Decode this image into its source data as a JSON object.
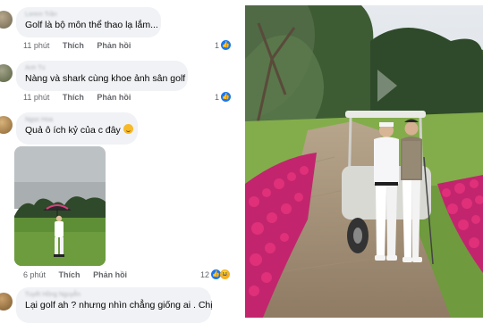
{
  "comments": [
    {
      "text": "Golf là bộ môn thể thao lạ lắm...",
      "time": "11 phút",
      "like_label": "Thích",
      "reply_label": "Phản hồi",
      "reaction_count": "1"
    },
    {
      "text": "Nàng và shark cùng khoe ảnh sân golf",
      "time": "11 phút",
      "like_label": "Thích",
      "reply_label": "Phản hồi",
      "reaction_count": "1"
    },
    {
      "text": "Quả ô ích kỷ của c đây",
      "time": "6 phút",
      "like_label": "Thích",
      "reply_label": "Phản hồi",
      "reaction_count": "12"
    },
    {
      "text": "Lại golf ah ? nhưng nhìn chẳng giống ai . Chị"
    }
  ],
  "colors": {
    "bubble": "#f0f2f5",
    "like": "#1877f2",
    "meta_text": "#65676b",
    "flowers": "#e0307a",
    "grass": "#6f9a3e"
  }
}
